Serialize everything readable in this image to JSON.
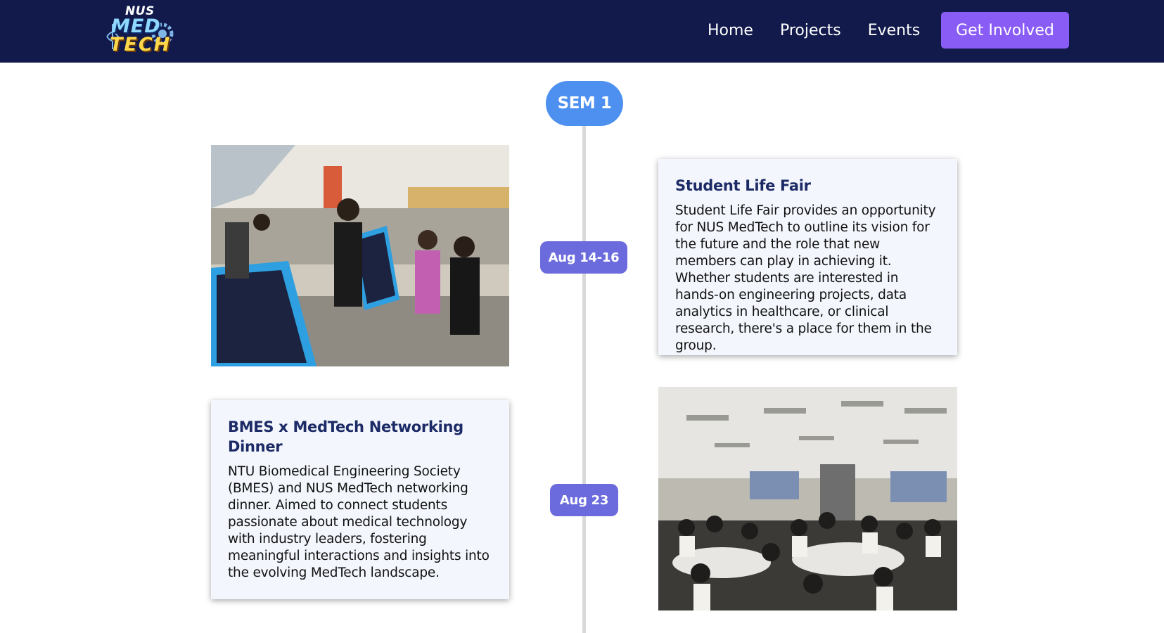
{
  "brand": {
    "logo_top": "NUS",
    "logo_mid": "MED",
    "logo_bottom": "TECH"
  },
  "nav": {
    "links": [
      {
        "label": "Home"
      },
      {
        "label": "Projects"
      },
      {
        "label": "Events"
      }
    ],
    "cta_label": "Get Involved"
  },
  "colors": {
    "navbar_bg": "#111a4b",
    "cta_bg": "#8a5cf6",
    "sem_pill": "#4d90f0",
    "date_pill": "#6b6bdd",
    "card_bg": "#f3f6fc",
    "card_title": "#1c2a66"
  },
  "timeline": {
    "semester_label": "SEM 1",
    "events": [
      {
        "date": "Aug 14-16",
        "title": "Student Life Fair",
        "description": "Student Life Fair provides an opportunity for NUS MedTech to outline its vision for the future and the role that new members can play in achieving it. Whether students are interested in hands-on engineering projects, data analytics in healthcare, or clinical research, there's a place for them in the group.",
        "photo": "student-life-fair-photo"
      },
      {
        "date": "Aug 23",
        "title": "BMES x MedTech Networking Dinner",
        "description": "NTU Biomedical Engineering Society (BMES) and NUS MedTech networking dinner. Aimed to connect students passionate about medical technology with industry leaders, fostering meaningful interactions and insights into the evolving MedTech landscape.",
        "photo": "networking-dinner-photo"
      }
    ]
  }
}
